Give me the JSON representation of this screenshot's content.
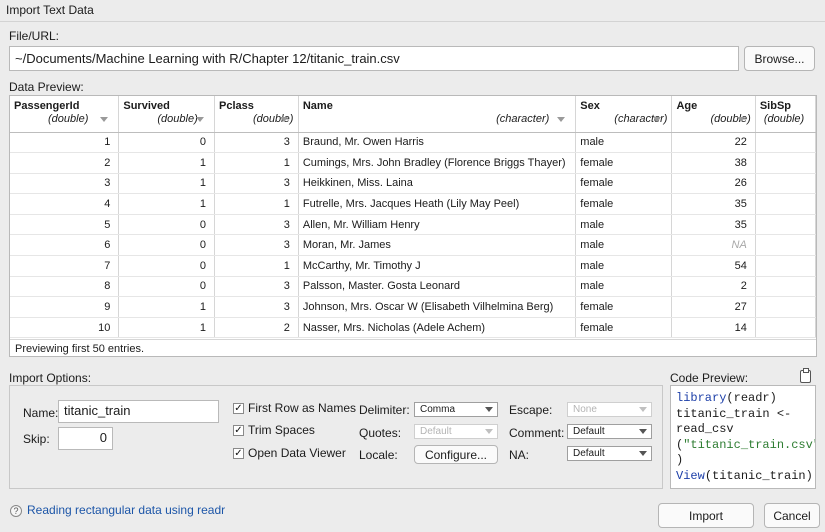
{
  "window": {
    "title": "Import Text Data"
  },
  "file": {
    "label": "File/URL:",
    "value": "~/Documents/Machine Learning with R/Chapter 12/titanic_train.csv",
    "browse_label": "Browse..."
  },
  "preview": {
    "label": "Data Preview:",
    "columns": [
      {
        "name": "PassengerId",
        "type": "(double)"
      },
      {
        "name": "Survived",
        "type": "(double)"
      },
      {
        "name": "Pclass",
        "type": "(double)"
      },
      {
        "name": "Name",
        "type": "(character)"
      },
      {
        "name": "Sex",
        "type": "(character)"
      },
      {
        "name": "Age",
        "type": "(double)"
      },
      {
        "name": "SibSp",
        "type": "(double)"
      }
    ],
    "rows": [
      [
        "1",
        "0",
        "3",
        "Braund, Mr. Owen Harris",
        "male",
        "22",
        ""
      ],
      [
        "2",
        "1",
        "1",
        "Cumings, Mrs. John Bradley (Florence Briggs Thayer)",
        "female",
        "38",
        ""
      ],
      [
        "3",
        "1",
        "3",
        "Heikkinen, Miss. Laina",
        "female",
        "26",
        ""
      ],
      [
        "4",
        "1",
        "1",
        "Futrelle, Mrs. Jacques Heath (Lily May Peel)",
        "female",
        "35",
        ""
      ],
      [
        "5",
        "0",
        "3",
        "Allen, Mr. William Henry",
        "male",
        "35",
        ""
      ],
      [
        "6",
        "0",
        "3",
        "Moran, Mr. James",
        "male",
        "NA",
        ""
      ],
      [
        "7",
        "0",
        "1",
        "McCarthy, Mr. Timothy J",
        "male",
        "54",
        ""
      ],
      [
        "8",
        "0",
        "3",
        "Palsson, Master. Gosta Leonard",
        "male",
        "2",
        ""
      ],
      [
        "9",
        "1",
        "3",
        "Johnson, Mrs. Oscar W (Elisabeth Vilhelmina Berg)",
        "female",
        "27",
        ""
      ],
      [
        "10",
        "1",
        "2",
        "Nasser, Mrs. Nicholas (Adele Achem)",
        "female",
        "14",
        ""
      ]
    ],
    "footer": "Previewing first 50 entries."
  },
  "import_options": {
    "label": "Import Options:",
    "name_label": "Name:",
    "name_value": "titanic_train",
    "skip_label": "Skip:",
    "skip_value": "0",
    "first_row_label": "First Row as Names",
    "first_row_checked": true,
    "trim_spaces_label": "Trim Spaces",
    "trim_spaces_checked": true,
    "open_viewer_label": "Open Data Viewer",
    "open_viewer_checked": true,
    "delimiter_label": "Delimiter:",
    "delimiter_value": "Comma",
    "quotes_label": "Quotes:",
    "quotes_value": "Default",
    "locale_label": "Locale:",
    "configure_label": "Configure...",
    "escape_label": "Escape:",
    "escape_value": "None",
    "comment_label": "Comment:",
    "comment_value": "Default",
    "na_label": "NA:",
    "na_value": "Default"
  },
  "code_preview": {
    "label": "Code Preview:",
    "lines": [
      {
        "fn": "library",
        "rest": "(readr)"
      },
      {
        "text": "titanic_train <-"
      },
      {
        "text": "read_csv"
      },
      {
        "text": "(",
        "str": "\"titanic_train.csv\""
      },
      {
        "text": ")"
      },
      {
        "fn": "View",
        "rest": "(titanic_train)"
      }
    ]
  },
  "footer": {
    "help_icon": "?",
    "help_link": "Reading rectangular data using readr",
    "import_label": "Import",
    "cancel_label": "Cancel"
  }
}
